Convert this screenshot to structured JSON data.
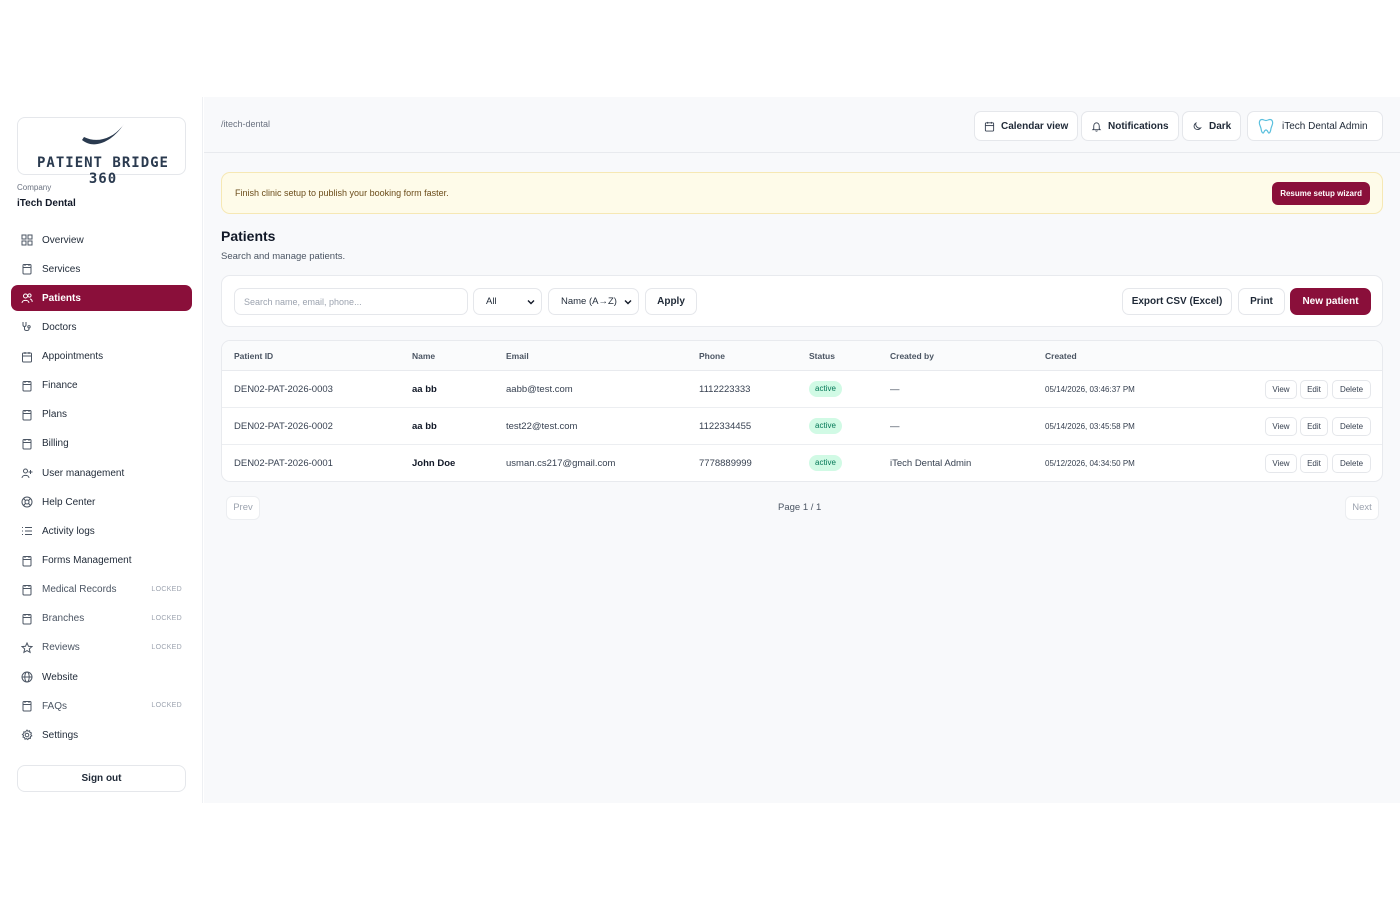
{
  "brand": {
    "logo_text": "PATIENT BRIDGE 360",
    "accent": "#8a0f3a"
  },
  "company": {
    "label": "Company",
    "name": "iTech Dental"
  },
  "sidebar": {
    "items": [
      {
        "label": "Overview",
        "icon": "grid-icon",
        "locked": ""
      },
      {
        "label": "Services",
        "icon": "clipboard-icon",
        "locked": ""
      },
      {
        "label": "Patients",
        "icon": "users-icon",
        "locked": ""
      },
      {
        "label": "Doctors",
        "icon": "stethoscope-icon",
        "locked": ""
      },
      {
        "label": "Appointments",
        "icon": "calendar-icon",
        "locked": ""
      },
      {
        "label": "Finance",
        "icon": "clipboard-icon",
        "locked": ""
      },
      {
        "label": "Plans",
        "icon": "clipboard-icon",
        "locked": ""
      },
      {
        "label": "Billing",
        "icon": "clipboard-icon",
        "locked": ""
      },
      {
        "label": "User management",
        "icon": "user-plus-icon",
        "locked": ""
      },
      {
        "label": "Help Center",
        "icon": "lifebuoy-icon",
        "locked": ""
      },
      {
        "label": "Activity logs",
        "icon": "list-icon",
        "locked": ""
      },
      {
        "label": "Forms Management",
        "icon": "clipboard-icon",
        "locked": ""
      },
      {
        "label": "Medical Records",
        "icon": "clipboard-icon",
        "locked": "LOCKED"
      },
      {
        "label": "Branches",
        "icon": "clipboard-icon",
        "locked": "LOCKED"
      },
      {
        "label": "Reviews",
        "icon": "star-icon",
        "locked": "LOCKED"
      },
      {
        "label": "Website",
        "icon": "globe-icon",
        "locked": ""
      },
      {
        "label": "FAQs",
        "icon": "clipboard-icon",
        "locked": "LOCKED"
      },
      {
        "label": "Settings",
        "icon": "gear-icon",
        "locked": ""
      }
    ],
    "active_index": 2,
    "signout_label": "Sign out"
  },
  "topbar": {
    "breadcrumb": "/itech-dental",
    "calendar_label": "Calendar view",
    "notifications_label": "Notifications",
    "theme_label": "Dark",
    "user_label": "iTech Dental Admin"
  },
  "banner": {
    "text": "Finish clinic setup to publish your booking form faster.",
    "button": "Resume setup wizard"
  },
  "page": {
    "title": "Patients",
    "subtitle": "Search and manage patients."
  },
  "filters": {
    "search_placeholder": "Search name, email, phone...",
    "search_value": "",
    "status_selected": "All",
    "sort_selected": "Name (A→Z)",
    "apply_label": "Apply",
    "export_label": "Export CSV (Excel)",
    "print_label": "Print",
    "new_label": "New patient"
  },
  "table": {
    "columns": [
      "Patient ID",
      "Name",
      "Email",
      "Phone",
      "Status",
      "Created by",
      "Created"
    ],
    "rows": [
      {
        "id": "DEN02-PAT-2026-0003",
        "name": "aa bb",
        "email": "aabb@test.com",
        "phone": "1112223333",
        "status": "active",
        "created_by": "—",
        "created": "05/14/2026, 03:46:37 PM"
      },
      {
        "id": "DEN02-PAT-2026-0002",
        "name": "aa bb",
        "email": "test22@test.com",
        "phone": "1122334455",
        "status": "active",
        "created_by": "—",
        "created": "05/14/2026, 03:45:58 PM"
      },
      {
        "id": "DEN02-PAT-2026-0001",
        "name": "John Doe",
        "email": "usman.cs217@gmail.com",
        "phone": "7778889999",
        "status": "active",
        "created_by": "iTech Dental Admin",
        "created": "05/12/2026, 04:34:50 PM"
      }
    ],
    "actions": {
      "view": "View",
      "edit": "Edit",
      "delete": "Delete"
    }
  },
  "pagination": {
    "prev": "Prev",
    "page_text": "Page 1 / 1",
    "next": "Next"
  }
}
